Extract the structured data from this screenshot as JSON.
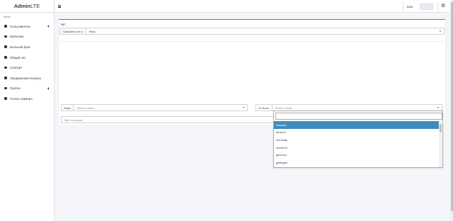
{
  "brand": {
    "bold": "Admin",
    "light": "LTE"
  },
  "sidebar": {
    "header": "Меню",
    "items": [
      {
        "label": "Пользователи",
        "icon": "users-icon",
        "has_children": true
      },
      {
        "label": "Бабосики",
        "icon": "money-icon",
        "has_children": false
      },
      {
        "label": "Большой брат",
        "icon": "eye-icon",
        "has_children": false
      },
      {
        "label": "Общий чат",
        "icon": "chat-icon",
        "has_children": false
      },
      {
        "label": "Саппорт",
        "icon": "support-icon",
        "has_children": false
      },
      {
        "label": "Защищенная покупка",
        "icon": "shield-icon",
        "has_children": false
      },
      {
        "label": "Группы",
        "icon": "group-icon",
        "has_children": true
      },
      {
        "label": "Уголок скамера",
        "icon": "scam-icon",
        "has_children": false
      }
    ]
  },
  "navbar": {
    "user_label": "BNN",
    "menu_icon": "hamburger-icon",
    "gear_icon": "gears-icon"
  },
  "card": {
    "title": "Чат",
    "watch_button": "Смотреть чат с",
    "watch_value": "Весь",
    "to_label": "Кому:",
    "to_placeholder": "Select a state",
    "from_label": "От бота:",
    "from_placeholder": "Select a state",
    "message_placeholder": "Type message..."
  },
  "dropdown": {
    "search_value": "",
    "options": [
      "kassyby",
      "derek21",
      "an12way",
      "ofeds110",
      "gelvrrry1",
      "golitogun"
    ],
    "highlighted": "kassyby"
  },
  "colors": {
    "accent": "#17a2b8",
    "highlight": "#3c8dbc"
  }
}
